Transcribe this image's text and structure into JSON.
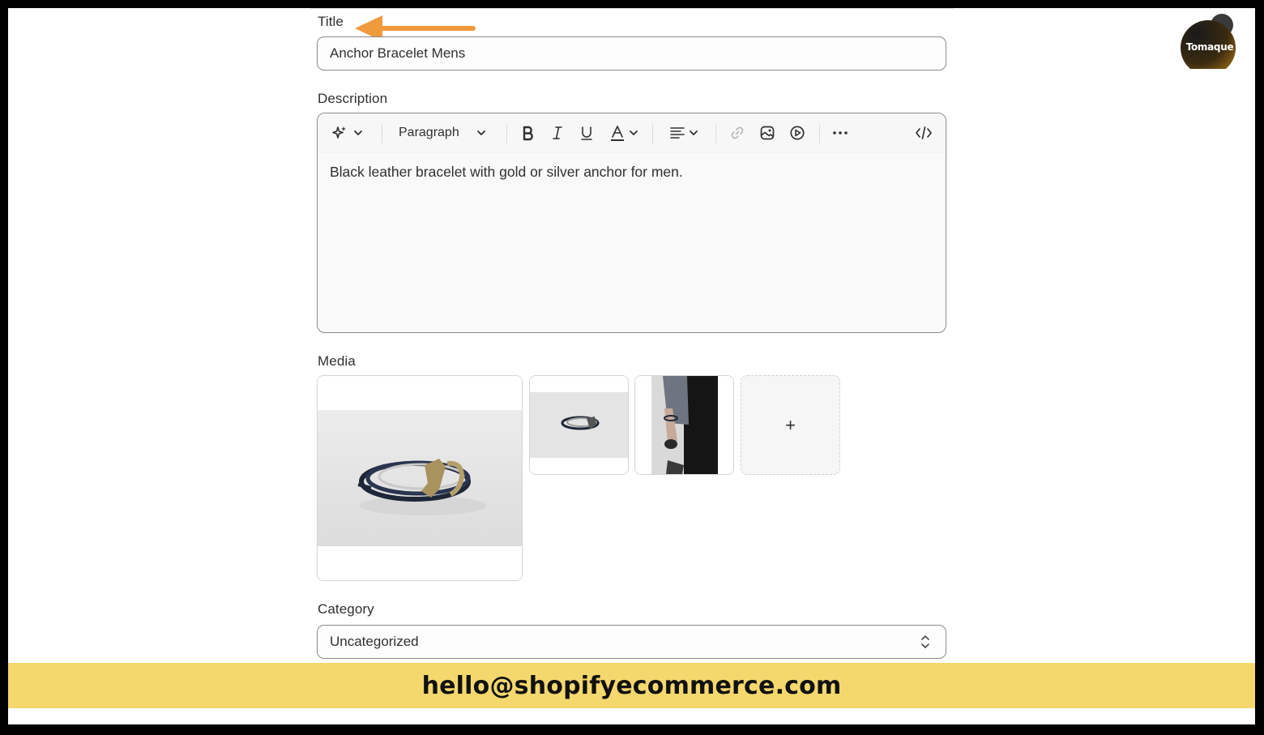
{
  "form": {
    "title_label": "Title",
    "title_value": "Anchor Bracelet Mens",
    "description_label": "Description",
    "toolbar": {
      "paragraph_label": "Paragraph",
      "icons": [
        "magic-icon",
        "chevron-down-icon",
        "bold-icon",
        "italic-icon",
        "underline-icon",
        "text-color-icon",
        "align-icon",
        "link-icon",
        "image-icon",
        "video-icon",
        "more-icon",
        "code-icon"
      ]
    },
    "description_text": "Black leather bracelet with gold or silver anchor for men.",
    "media_label": "Media",
    "add_media_symbol": "+",
    "category_label": "Category",
    "category_value": "Uncategorized"
  },
  "overlay": {
    "logo_text": "Tomaque",
    "arrow_color": "#f09a3e",
    "banner_text": "hello@shopifyecommerce.com",
    "banner_color": "#f4d86e"
  }
}
